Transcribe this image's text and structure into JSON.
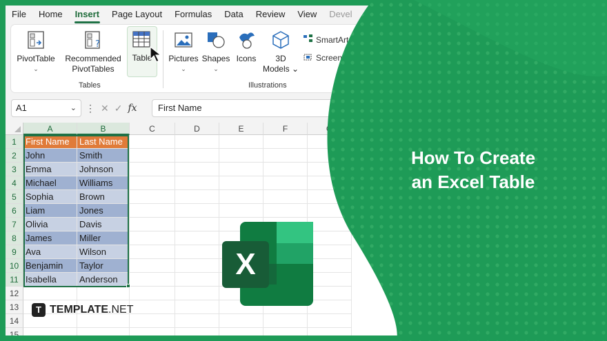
{
  "menu": {
    "items": [
      "File",
      "Home",
      "Insert",
      "Page Layout",
      "Formulas",
      "Data",
      "Review",
      "View",
      "Devel"
    ],
    "active_index": 2
  },
  "ribbon": {
    "pivot_table": "PivotTable",
    "recommended": "Recommended",
    "pivot_tables": "PivotTables",
    "table": "Table",
    "tables_group": "Tables",
    "pictures": "Pictures",
    "shapes": "Shapes",
    "icons": "Icons",
    "models_3d_line1": "3D",
    "models_3d_line2": "Models",
    "smartart": "SmartArt",
    "screenshot": "Screenshot",
    "illustrations_group": "Illustrations"
  },
  "formula_bar": {
    "name_box": "A1",
    "fx": "fx",
    "value": "First Name"
  },
  "sheet": {
    "columns": [
      "A",
      "B",
      "C",
      "D",
      "E",
      "F",
      "G"
    ],
    "rows": [
      "1",
      "2",
      "3",
      "4",
      "5",
      "6",
      "7",
      "8",
      "9",
      "10",
      "11",
      "12",
      "13",
      "14",
      "15"
    ],
    "headers": [
      "First Name",
      "Last Name"
    ],
    "data": [
      [
        "John",
        "Smith"
      ],
      [
        "Emma",
        "Johnson"
      ],
      [
        "Michael",
        "Williams"
      ],
      [
        "Sophia",
        "Brown"
      ],
      [
        "Liam",
        "Jones"
      ],
      [
        "Olivia",
        "Davis"
      ],
      [
        "James",
        "Miller"
      ],
      [
        "Ava",
        "Wilson"
      ],
      [
        "Benjamin",
        "Taylor"
      ],
      [
        "Isabella",
        "Anderson"
      ]
    ]
  },
  "headline": {
    "line1": "How To Create",
    "line2": "an Excel Table"
  },
  "brand": {
    "logo_letter": "T",
    "name_bold": "TEMPLATE",
    "name_suffix": ".NET"
  },
  "colors": {
    "excel_green": "#1e7145",
    "frame_green": "#1e9b57",
    "table_header": "#e07b39",
    "table_band_dark": "#9fb1d1",
    "table_band_light": "#c7d1e3"
  },
  "icons": [
    "pivottable-icon",
    "recommended-pivot-icon",
    "table-icon",
    "pictures-icon",
    "shapes-icon",
    "icons-icon",
    "3d-models-icon",
    "smartart-icon",
    "screenshot-icon",
    "excel-logo-icon",
    "mouse-cursor-icon"
  ]
}
